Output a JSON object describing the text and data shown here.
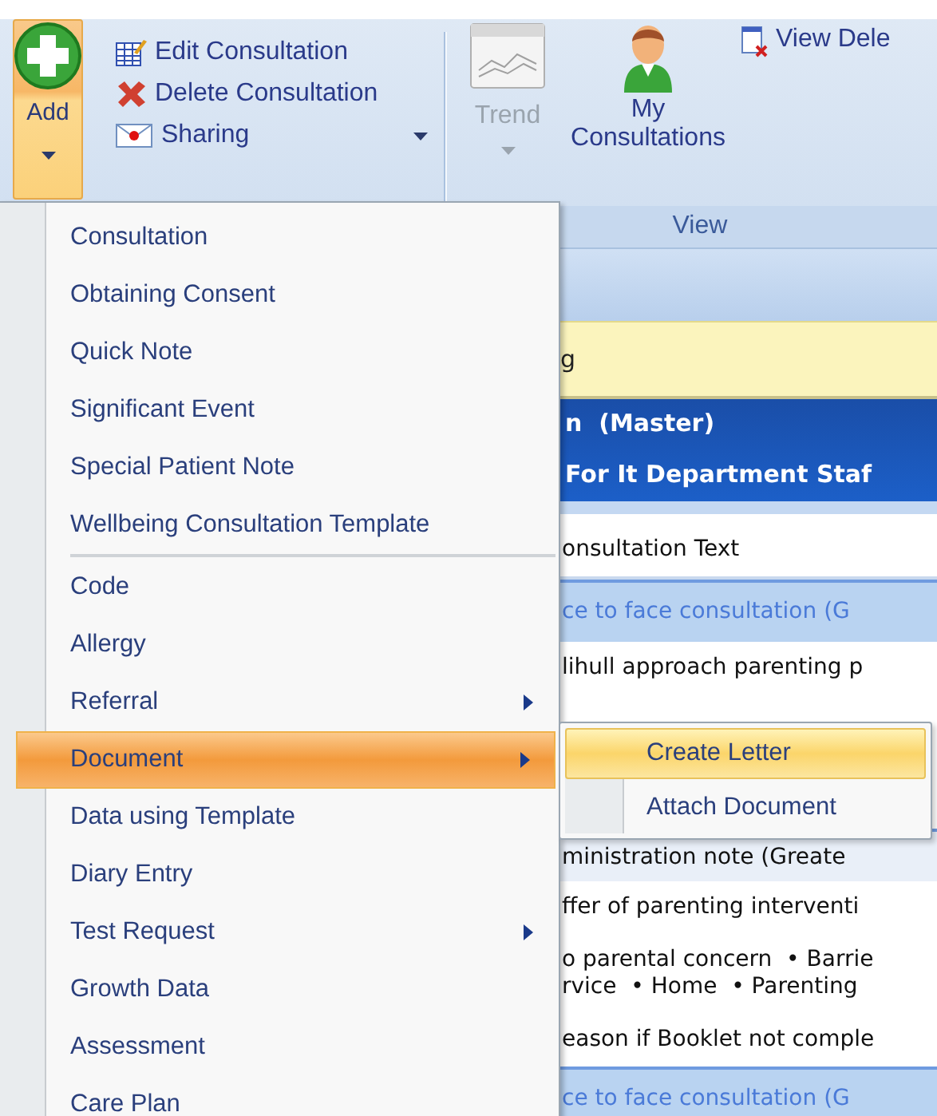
{
  "ribbon": {
    "add_button": {
      "label": "Add",
      "pressed": true
    },
    "small_buttons": [
      {
        "kind": "edit",
        "label": "Edit Consultation",
        "dropdown": false
      },
      {
        "kind": "delete",
        "label": "Delete Consultation",
        "dropdown": false
      },
      {
        "kind": "sharing",
        "label": "Sharing",
        "dropdown": true
      }
    ],
    "trend": {
      "label": "Trend",
      "disabled": true
    },
    "my_consultations": {
      "label": "My Consultations"
    },
    "view_deleted": {
      "label": "View Dele"
    },
    "group_label": "View"
  },
  "record": {
    "banner": "g",
    "header_lines": [
      "n  (Master)",
      "For It Department Staf"
    ],
    "rows": [
      {
        "kind": "heading",
        "lines": [
          "onsultation Text"
        ]
      },
      {
        "kind": "entry",
        "lines": [
          "ce to face consultation (G"
        ]
      },
      {
        "kind": "plain",
        "lines": [
          "lihull approach parenting p"
        ]
      },
      {
        "kind": "shaded",
        "lines": [
          "ministration note (Greate"
        ]
      },
      {
        "kind": "plain",
        "lines": [
          "ffer of parenting interventi"
        ]
      },
      {
        "kind": "plain",
        "lines": [
          "o parental concern  • Barrie",
          "rvice  • Home  • Parenting"
        ]
      },
      {
        "kind": "plain",
        "lines": [
          "eason if Booklet not comple"
        ]
      },
      {
        "kind": "entry",
        "lines": [
          "ce to face consultation (G"
        ]
      }
    ]
  },
  "add_menu": {
    "items": [
      {
        "kind": "item",
        "label": "Consultation",
        "selected": false,
        "submenu": false
      },
      {
        "kind": "item",
        "label": "Obtaining Consent",
        "selected": false,
        "submenu": false
      },
      {
        "kind": "item",
        "label": "Quick Note",
        "selected": false,
        "submenu": false
      },
      {
        "kind": "item",
        "label": "Significant Event",
        "selected": false,
        "submenu": false
      },
      {
        "kind": "item",
        "label": "Special Patient Note",
        "selected": false,
        "submenu": false
      },
      {
        "kind": "item",
        "label": "Wellbeing Consultation Template",
        "selected": false,
        "submenu": false
      },
      {
        "kind": "separator"
      },
      {
        "kind": "item",
        "label": "Code",
        "selected": false,
        "submenu": false
      },
      {
        "kind": "item",
        "label": "Allergy",
        "selected": false,
        "submenu": false
      },
      {
        "kind": "item",
        "label": "Referral",
        "selected": false,
        "submenu": true
      },
      {
        "kind": "item",
        "label": "Document",
        "selected": true,
        "submenu": true
      },
      {
        "kind": "item",
        "label": "Data using Template",
        "selected": false,
        "submenu": false
      },
      {
        "kind": "item",
        "label": "Diary Entry",
        "selected": false,
        "submenu": false
      },
      {
        "kind": "item",
        "label": "Test Request",
        "selected": false,
        "submenu": true
      },
      {
        "kind": "item",
        "label": "Growth Data",
        "selected": false,
        "submenu": false
      },
      {
        "kind": "item",
        "label": "Assessment",
        "selected": false,
        "submenu": false
      },
      {
        "kind": "item",
        "label": "Care Plan",
        "selected": false,
        "submenu": false
      }
    ]
  },
  "document_submenu": {
    "items": [
      {
        "label": "Create Letter",
        "selected": true
      },
      {
        "label": "Attach Document",
        "selected": false
      }
    ]
  }
}
